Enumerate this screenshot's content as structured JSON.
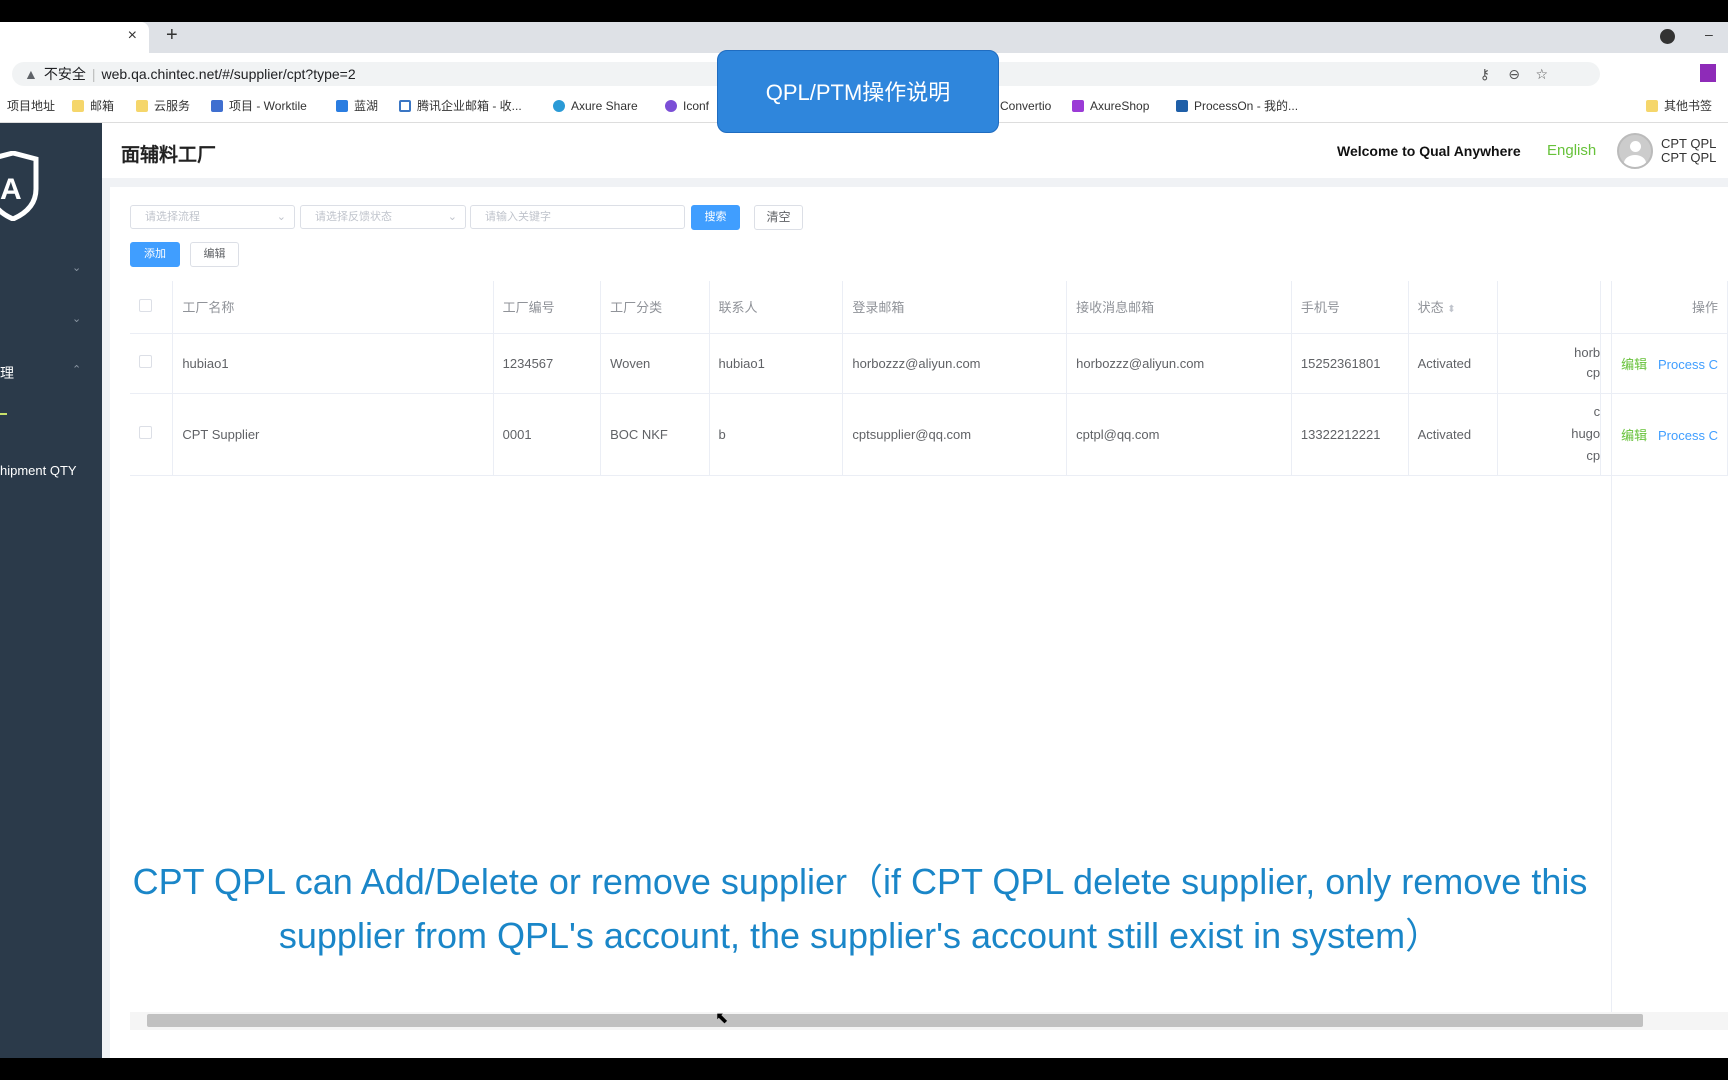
{
  "browser": {
    "tab_close": "×",
    "new_tab": "+",
    "security_label": "不安全",
    "url": "web.qa.chintec.net/#/supplier/cpt?type=2",
    "bookmarks": [
      "项目地址",
      "邮箱",
      "云服务",
      "项目 - Worktile",
      "蓝湖",
      "腾讯企业邮箱 - 收...",
      "Axure Share",
      "Iconf",
      "Convertio",
      "AxureShop",
      "ProcessOn - 我的..."
    ],
    "other_bookmarks": "其他书签"
  },
  "overlay": {
    "button": "QPL/PTM操作说明",
    "caption_line1": "CPT QPL can Add/Delete or remove supplier（if CPT QPL delete supplier, only remove this",
    "caption_line2": "supplier from QPL's account, the supplier's account still exist in system）"
  },
  "sidebar": {
    "partial_item": "理",
    "partial_item2": "hipment QTY"
  },
  "header": {
    "title": "面辅料工厂",
    "welcome": "Welcome to Qual Anywhere",
    "language": "English",
    "user_line1": "CPT QPL",
    "user_line2": "CPT QPL"
  },
  "filters": {
    "process_placeholder": "请选择流程",
    "feedback_placeholder": "请选择反馈状态",
    "keyword_placeholder": "请输入关键字",
    "search": "搜索",
    "clear": "清空",
    "add": "添加",
    "edit": "编辑"
  },
  "table": {
    "headers": [
      "工厂名称",
      "工厂编号",
      "工厂分类",
      "联系人",
      "登录邮箱",
      "接收消息邮箱",
      "手机号",
      "状态",
      "",
      "操作"
    ],
    "rows": [
      {
        "name": "hubiao1",
        "code": "1234567",
        "type": "Woven",
        "contact": "hubiao1",
        "login_email": "horbozzz@aliyun.com",
        "recv_email": "horbozzz@aliyun.com",
        "phone": "15252361801",
        "status": "Activated",
        "extra1": "horb",
        "extra2": "cp",
        "extra3": "",
        "edit": "编辑",
        "process": "Process C"
      },
      {
        "name": "CPT Supplier",
        "code": "0001",
        "type": "BOC NKF",
        "contact": "b",
        "login_email": "cptsupplier@qq.com",
        "recv_email": "cptpl@qq.com",
        "phone": "13322212221",
        "status": "Activated",
        "extra1": "c",
        "extra2": "hugo",
        "extra3": "cp",
        "edit": "编辑",
        "process": "Process C"
      }
    ]
  },
  "colors": {
    "primary": "#409eff",
    "sidebar": "#2b3a4a",
    "caption": "#1a86c8",
    "edit_link": "#67c23a"
  }
}
